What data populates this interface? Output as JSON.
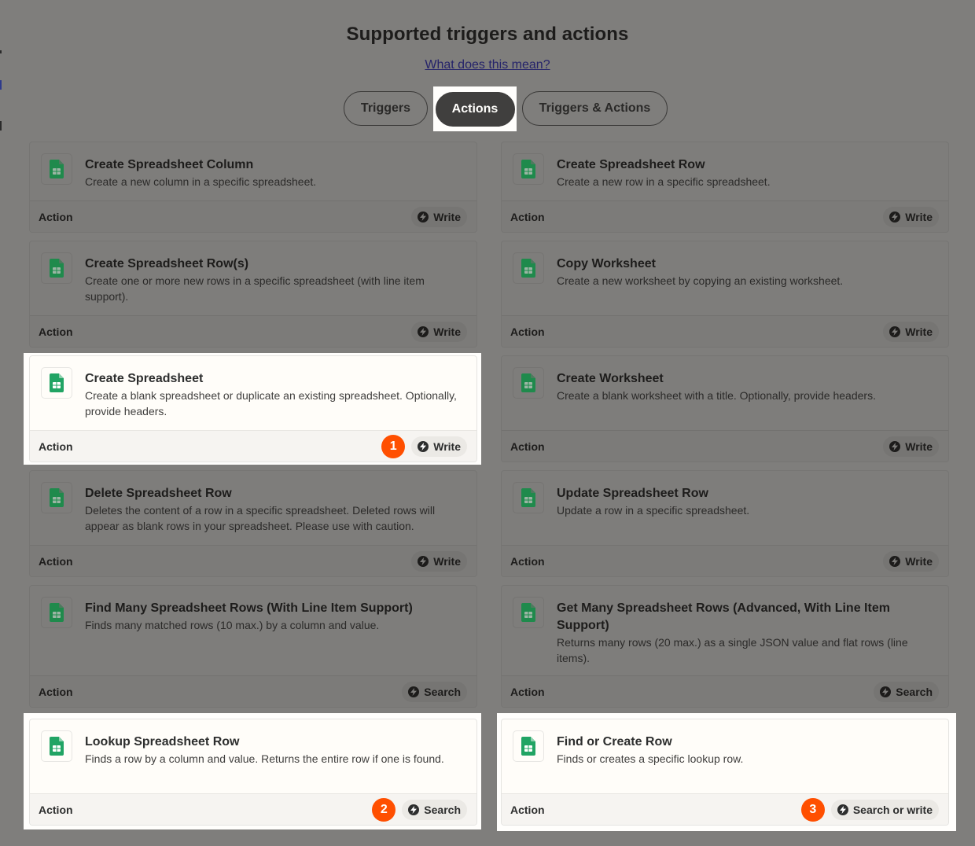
{
  "header": {
    "title": "Supported triggers and actions",
    "help_link": "What does this mean?"
  },
  "tabs": [
    {
      "label": "Triggers",
      "selected": false
    },
    {
      "label": "Actions",
      "selected": true
    },
    {
      "label": "Triggers & Actions",
      "selected": false
    }
  ],
  "icons": {
    "app": "google-sheets-icon",
    "badge": "bolt-icon"
  },
  "colors": {
    "accent": "#ff4f00",
    "sheets_green": "#1f8a4c",
    "selected_tab": "#403f3e",
    "link": "#25236a"
  },
  "cards": [
    {
      "title": "Create Spreadsheet Column",
      "desc": "Create a new column in a specific spreadsheet.",
      "type": "Action",
      "badge": "Write",
      "highlighted": false
    },
    {
      "title": "Create Spreadsheet Row",
      "desc": "Create a new row in a specific spreadsheet.",
      "type": "Action",
      "badge": "Write",
      "highlighted": false
    },
    {
      "title": "Create Spreadsheet Row(s)",
      "desc": "Create one or more new rows in a specific spreadsheet (with line item support).",
      "type": "Action",
      "badge": "Write",
      "highlighted": false
    },
    {
      "title": "Copy Worksheet",
      "desc": "Create a new worksheet by copying an existing worksheet.",
      "type": "Action",
      "badge": "Write",
      "highlighted": false
    },
    {
      "title": "Create Spreadsheet",
      "desc": "Create a blank spreadsheet or duplicate an existing spreadsheet. Optionally, provide headers.",
      "type": "Action",
      "badge": "Write",
      "highlighted": true,
      "step": "1"
    },
    {
      "title": "Create Worksheet",
      "desc": "Create a blank worksheet with a title. Optionally, provide headers.",
      "type": "Action",
      "badge": "Write",
      "highlighted": false
    },
    {
      "title": "Delete Spreadsheet Row",
      "desc": "Deletes the content of a row in a specific spreadsheet. Deleted rows will appear as blank rows in your spreadsheet. Please use with caution.",
      "type": "Action",
      "badge": "Write",
      "highlighted": false
    },
    {
      "title": "Update Spreadsheet Row",
      "desc": "Update a row in a specific spreadsheet.",
      "type": "Action",
      "badge": "Write",
      "highlighted": false
    },
    {
      "title": "Find Many Spreadsheet Rows (With Line Item Support)",
      "desc": "Finds many matched rows (10 max.) by a column and value.",
      "type": "Action",
      "badge": "Search",
      "highlighted": false
    },
    {
      "title": "Get Many Spreadsheet Rows (Advanced, With Line Item Support)",
      "desc": "Returns many rows (20 max.) as a single JSON value and flat rows (line items).",
      "type": "Action",
      "badge": "Search",
      "highlighted": false
    },
    {
      "title": "Lookup Spreadsheet Row",
      "desc": "Finds a row by a column and value. Returns the entire row if one is found.",
      "type": "Action",
      "badge": "Search",
      "highlighted": true,
      "step": "2"
    },
    {
      "title": "Find or Create Row",
      "desc": "Finds or creates a specific lookup row.",
      "type": "Action",
      "badge": "Search or write",
      "highlighted": true,
      "step": "3"
    }
  ]
}
